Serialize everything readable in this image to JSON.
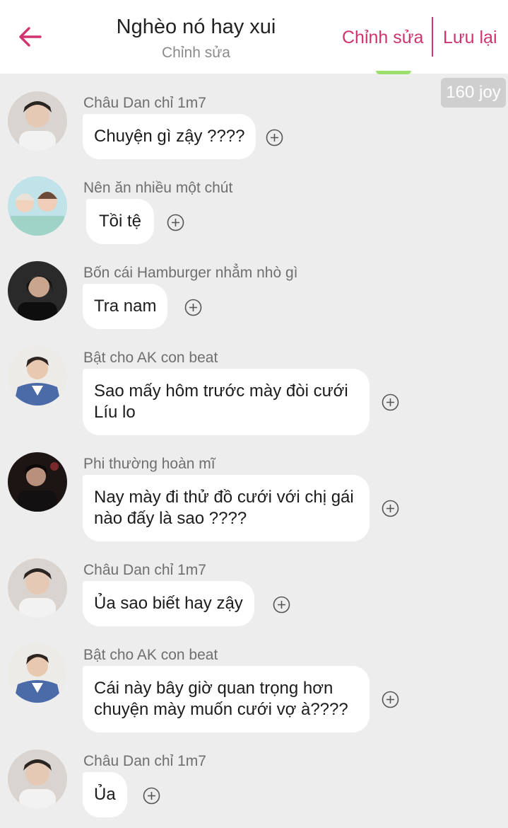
{
  "header": {
    "title": "Nghèo nó hay xui",
    "subtitle": "Chỉnh sửa",
    "edit_label": "Chỉnh sửa",
    "save_label": "Lưu lại",
    "accent_color": "#d1336f"
  },
  "badge": {
    "label": "160 joy"
  },
  "messages": [
    {
      "name": "Châu Dan chỉ 1m7",
      "text": "Chuyện gì zậy ????"
    },
    {
      "name": "Nên ăn nhiều một chút",
      "text": "Tồi tệ"
    },
    {
      "name": "Bốn cái Hamburger nhẳm nhò gì",
      "text": "Tra nam"
    },
    {
      "name": "Bật cho AK con beat",
      "text": "Sao mấy hôm trước mày đòi cưới Líu lo"
    },
    {
      "name": "Phi thường hoàn mĩ",
      "text": "Nay mày đi thử đồ cưới với chị gái nào đấy là sao ????"
    },
    {
      "name": "Châu Dan chỉ 1m7",
      "text": "Ủa sao biết hay zậy"
    },
    {
      "name": "Bật cho AK con beat",
      "text": "Cái này bây giờ quan trọng hơn chuyện mày muốn cưới vợ à????"
    },
    {
      "name": "Châu Dan chỉ 1m7",
      "text": "Ủa"
    }
  ]
}
